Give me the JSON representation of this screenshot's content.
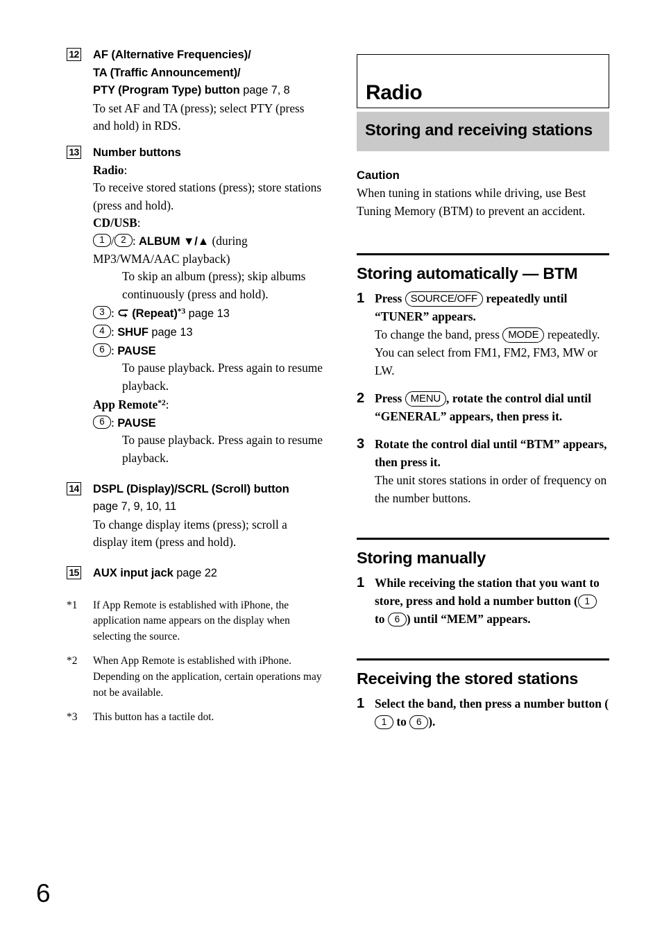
{
  "page": {
    "folio": "6"
  },
  "left_column": {
    "items": [
      {
        "marker": "12",
        "title_lines": [
          "AF (Alternative Frequencies)/",
          "TA (Traffic Announcement)/",
          "PTY (Program Type) button"
        ],
        "page_ref": "page 7, 8",
        "desc": "To set AF and TA (press); select PTY (press and hold) in RDS."
      },
      {
        "marker": "13",
        "title": "Number buttons",
        "radio_label": "Radio",
        "radio_desc": "To receive stored stations (press); store stations (press and hold).",
        "cdusb_label": "CD/USB",
        "cdusb_line1_btn_a": "1",
        "cdusb_line1_btn_b": "2",
        "cdusb_line1_bold": "ALBUM ▼/▲",
        "cdusb_line1_rest": "(during MP3/WMA/AAC playback)",
        "cdusb_line1_sub": "To skip an album (press); skip albums continuously (press and hold).",
        "repeat_btn": "3",
        "repeat_label": "(Repeat)",
        "repeat_footnote": "*3",
        "repeat_page": "page 13",
        "shuf_btn": "4",
        "shuf_label": "SHUF",
        "shuf_page": "page 13",
        "pause_btn": "6",
        "pause_label": "PAUSE",
        "pause_desc": "To pause playback. Press again to resume playback.",
        "appremote_label": "App Remote",
        "appremote_footnote": "*2",
        "appremote_pause_btn": "6",
        "appremote_pause_label": "PAUSE",
        "appremote_pause_desc": "To pause playback. Press again to resume playback."
      },
      {
        "marker": "14",
        "title": "DSPL (Display)/SCRL (Scroll) button",
        "page_ref": "page 7, 9, 10, 11",
        "desc": "To change display items (press); scroll a display item (press and hold)."
      },
      {
        "marker": "15",
        "title": "AUX input jack",
        "page_ref": "page 22"
      }
    ],
    "footnotes": [
      {
        "mark": "*1",
        "text": "If App Remote is established with iPhone, the application name appears on the display when selecting the source."
      },
      {
        "mark": "*2",
        "text": "When App Remote is established with iPhone. Depending on the application, certain operations may not be available."
      },
      {
        "mark": "*3",
        "text": "This button has a tactile dot."
      }
    ]
  },
  "right_column": {
    "chapter_title": "Radio",
    "section_banner": "Storing and receiving stations",
    "caution_heading": "Caution",
    "caution_body": "When tuning in stations while driving, use Best Tuning Memory (BTM) to prevent an accident.",
    "sections": [
      {
        "heading": "Storing automatically — BTM",
        "steps": [
          {
            "num": "1",
            "main_pre": "Press",
            "keycap": "SOURCE/OFF",
            "main_post": "repeatedly until “TUNER” appears.",
            "sub_pre": "To change the band, press",
            "sub_keycap": "MODE",
            "sub_post": "repeatedly. You can select from FM1, FM2, FM3, MW or LW."
          },
          {
            "num": "2",
            "main_pre": "Press",
            "keycap": "MENU",
            "main_post": ", rotate the control dial until “GENERAL” appears, then press it."
          },
          {
            "num": "3",
            "main": "Rotate the control dial until “BTM” appears, then press it.",
            "sub": "The unit stores stations in order of frequency on the number buttons."
          }
        ]
      },
      {
        "heading": "Storing manually",
        "steps": [
          {
            "num": "1",
            "main_pre": "While receiving the station that you want to store, press and hold a number button (",
            "btn_a": "1",
            "main_mid": "to",
            "btn_b": "6",
            "main_post": ") until “MEM” appears."
          }
        ]
      },
      {
        "heading": "Receiving the stored stations",
        "steps": [
          {
            "num": "1",
            "main_pre": "Select the band, then press a number button (",
            "btn_a": "1",
            "main_mid": "to",
            "btn_b": "6",
            "main_post": ")."
          }
        ]
      }
    ]
  },
  "colors": {
    "banner_gray": "#c9c9c9",
    "text": "#000000",
    "page_bg": "#ffffff"
  }
}
